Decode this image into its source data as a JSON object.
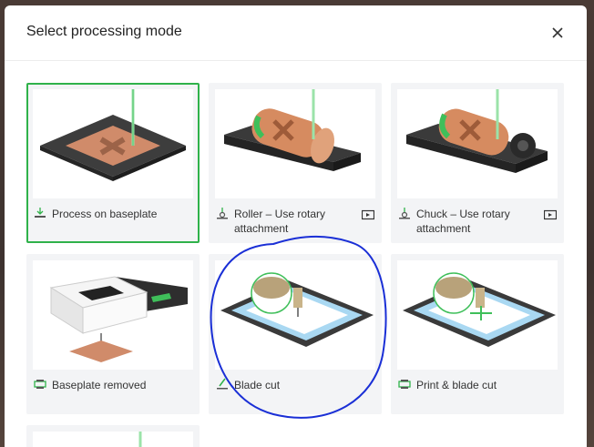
{
  "dialog": {
    "title": "Select processing mode",
    "close_icon": "close-icon"
  },
  "modes": [
    {
      "label": "Process on baseplate",
      "icon": "baseplate-icon",
      "selected": true
    },
    {
      "label": "Roller – Use rotary attachment",
      "icon": "roller-icon",
      "video": true
    },
    {
      "label": "Chuck – Use rotary attachment",
      "icon": "chuck-icon",
      "video": true
    },
    {
      "label": "Baseplate removed",
      "icon": "printer-icon"
    },
    {
      "label": "Blade cut",
      "icon": "blade-icon"
    },
    {
      "label": "Print & blade cut",
      "icon": "printer-icon"
    }
  ],
  "colors": {
    "selected_border": "#2fb24a",
    "annotation_stroke": "#1a2fd6"
  }
}
